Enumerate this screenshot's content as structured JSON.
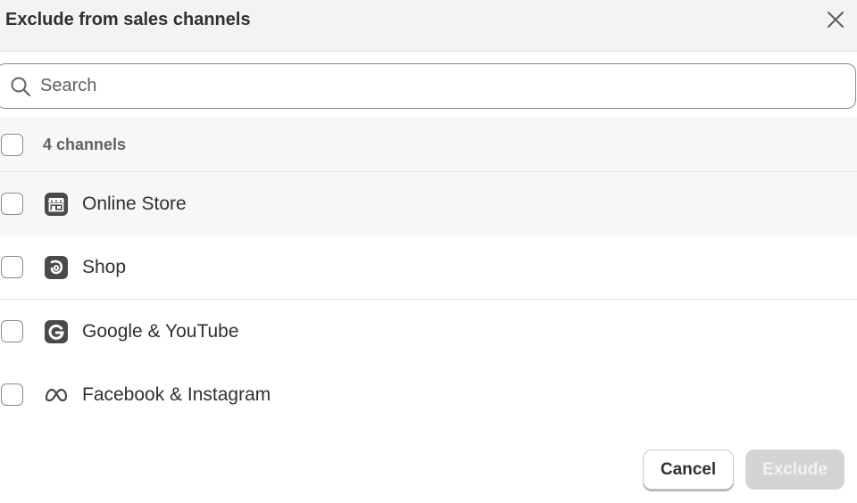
{
  "header": {
    "title": "Exclude from sales channels",
    "close_icon": "close-icon"
  },
  "search": {
    "placeholder": "Search",
    "value": "",
    "icon": "search-icon"
  },
  "list_header": {
    "count_label": "4 channels",
    "select_all_checked": false
  },
  "channels": [
    {
      "label": "Online Store",
      "icon": "storefront-icon",
      "checked": false,
      "hovered": true
    },
    {
      "label": "Shop",
      "icon": "shop-app-icon",
      "checked": false,
      "hovered": false
    },
    {
      "label": "Google & YouTube",
      "icon": "google-icon",
      "checked": false,
      "hovered": false
    },
    {
      "label": "Facebook & Instagram",
      "icon": "meta-icon",
      "checked": false,
      "hovered": false
    }
  ],
  "footer": {
    "cancel_label": "Cancel",
    "exclude_label": "Exclude",
    "exclude_disabled": true
  },
  "colors": {
    "header_bg": "#f3f3f3",
    "text": "#303030",
    "muted_text": "#616161",
    "border": "#e3e3e3",
    "disabled_button_bg": "#d4d4d4",
    "icon_dark": "#4a4a4a"
  }
}
